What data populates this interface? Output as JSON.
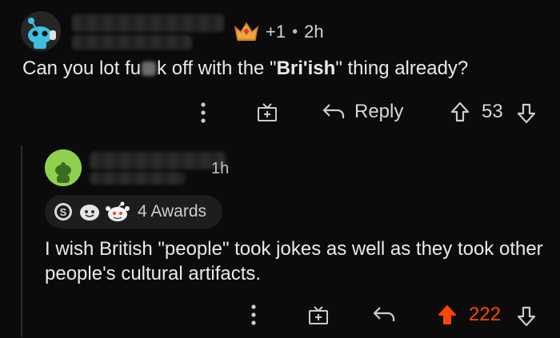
{
  "comment1": {
    "karma_badge": "+1",
    "separator": "•",
    "age": "2h",
    "body": {
      "part1": "Can you lot fu",
      "part2": "k off with the \"",
      "bold": "Bri'ish",
      "part3": "\" thing already?"
    },
    "actions": {
      "reply_label": "Reply",
      "score": "53"
    }
  },
  "comment2": {
    "age": "1h",
    "awards_label": "4 Awards",
    "body": "I wish British \"people\" took jokes as well as they took other people's cultural artifacts.",
    "actions": {
      "score": "222"
    }
  },
  "colors": {
    "background": "#0b0b0b",
    "upvote_active": "#ff4500",
    "text": "#e8eaeb",
    "avatar2_bg": "#8fd14f"
  },
  "icons": [
    "snoo-avatar-icon",
    "crown-award-icon",
    "more-options-icon",
    "gift-award-icon",
    "reply-arrow-icon",
    "upvote-arrow-icon",
    "downvote-arrow-icon",
    "silver-award-icon"
  ]
}
